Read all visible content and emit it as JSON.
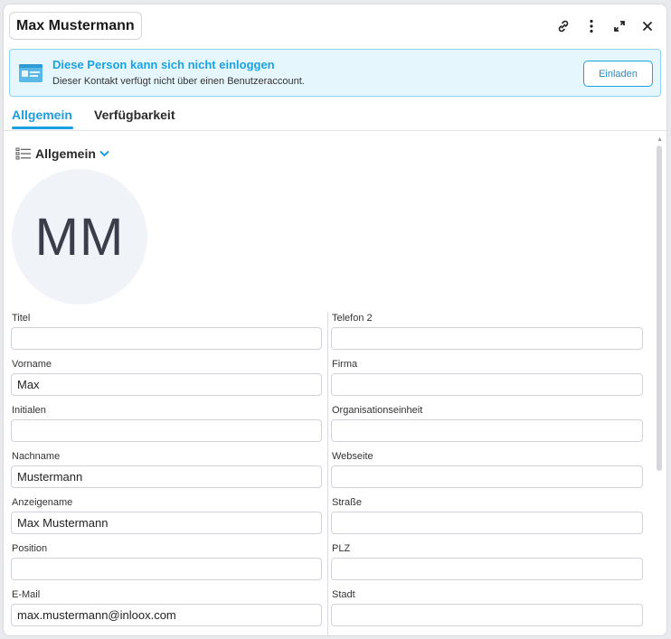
{
  "window": {
    "title": "Max Mustermann"
  },
  "banner": {
    "title": "Diese Person kann sich nicht einloggen",
    "text": "Dieser Kontakt verfügt nicht über einen Benutzeraccount.",
    "button": "Einladen",
    "accent": "#1ba3e0"
  },
  "tabs": [
    {
      "label": "Allgemein",
      "active": true
    },
    {
      "label": "Verfügbarkeit",
      "active": false
    }
  ],
  "section": {
    "title": "Allgemein"
  },
  "avatar": {
    "initials": "MM"
  },
  "fields_left": [
    {
      "label": "Titel",
      "value": ""
    },
    {
      "label": "Vorname",
      "value": "Max"
    },
    {
      "label": "Initialen",
      "value": ""
    },
    {
      "label": "Nachname",
      "value": "Mustermann"
    },
    {
      "label": "Anzeigename",
      "value": "Max Mustermann"
    },
    {
      "label": "Position",
      "value": ""
    },
    {
      "label": "E-Mail",
      "value": "max.mustermann@inloox.com"
    }
  ],
  "fields_right": [
    {
      "label": "Telefon 2",
      "value": ""
    },
    {
      "label": "Firma",
      "value": ""
    },
    {
      "label": "Organisationseinheit",
      "value": ""
    },
    {
      "label": "Webseite",
      "value": ""
    },
    {
      "label": "Straße",
      "value": ""
    },
    {
      "label": "PLZ",
      "value": ""
    },
    {
      "label": "Stadt",
      "value": ""
    }
  ]
}
